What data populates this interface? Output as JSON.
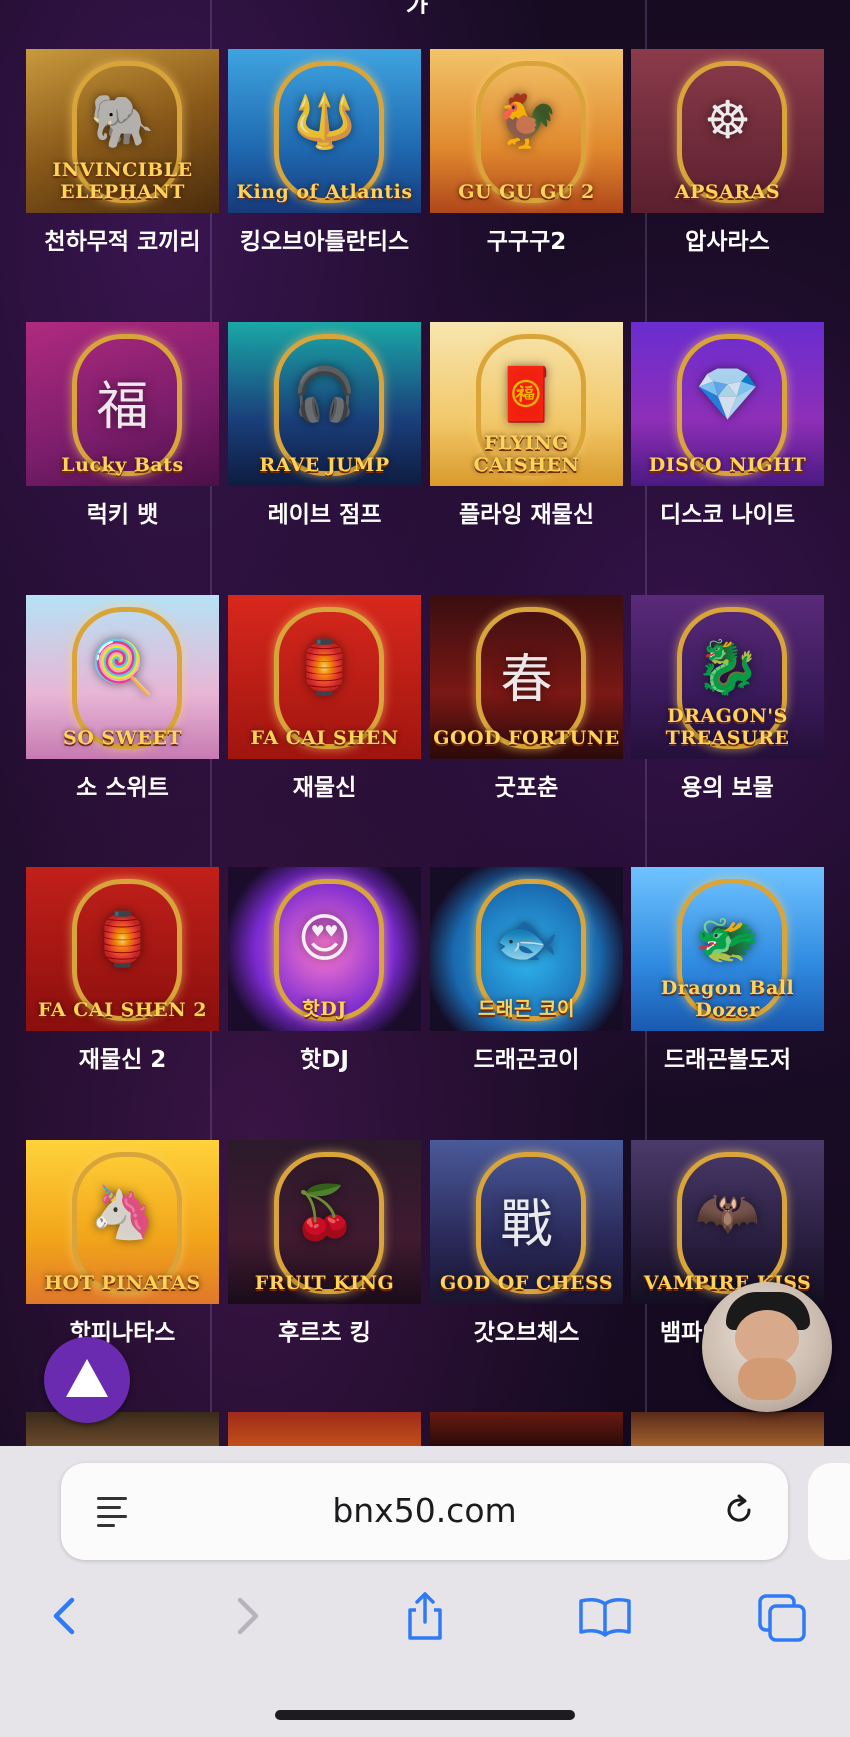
{
  "colors": {
    "accent_blue": "#2f7bf5",
    "up_button": "#6a2bb0",
    "gold": "#ffd25a"
  },
  "header_partial_text": "가",
  "games": [
    {
      "name": "천하무적 코끼리",
      "logo": "INVINCIBLE ELEPHANT",
      "bg": "linear-gradient(160deg,#c99a3d 0%,#8a5a1a 50%,#4a2c0c 100%)",
      "glyph": "🐘"
    },
    {
      "name": "킹오브아틀란티스",
      "logo": "King of Atlantis",
      "bg": "linear-gradient(180deg,#3fa4e0 0%,#1f6ab2 60%,#173a7a 100%)",
      "glyph": "🔱"
    },
    {
      "name": "구구구2",
      "logo": "GU GU GU 2",
      "bg": "linear-gradient(180deg,#f3c46a 0%,#e0892e 60%,#b0471a 100%)",
      "glyph": "🐓"
    },
    {
      "name": "압사라스",
      "logo": "APSARAS",
      "bg": "linear-gradient(180deg,#8b3b4a 0%,#5a1f2e 100%)",
      "glyph": "☸"
    },
    {
      "name": "럭키 뱃",
      "logo": "Lucky Bats",
      "bg": "linear-gradient(160deg,#b02a80 0%,#7a1d6a 60%,#4c0f48 100%)",
      "glyph": "福"
    },
    {
      "name": "레이브 점프",
      "logo": "RAVE JUMP",
      "bg": "linear-gradient(180deg,#1aa8a6 0%,#1a3e7a 60%,#0e1c40 100%)",
      "glyph": "🎧"
    },
    {
      "name": "플라잉 재물신",
      "logo": "FLYING CAISHEN",
      "bg": "linear-gradient(180deg,#f7e6b0 0%,#f2c86a 60%,#d99a2b 100%)",
      "glyph": "🧧"
    },
    {
      "name": "디스코 나이트",
      "logo": "DISCO NIGHT",
      "bg": "linear-gradient(180deg,#6a2dd0 0%,#8e2fb8 60%,#4a1a80 100%)",
      "glyph": "💎"
    },
    {
      "name": "소 스위트",
      "logo": "SO SWEET",
      "bg": "linear-gradient(180deg,#b6e2f5 0%,#e8b6d6 60%,#c77ab2 100%)",
      "glyph": "🍭"
    },
    {
      "name": "재물신",
      "logo": "FA CAI SHEN",
      "bg": "linear-gradient(180deg,#d8281d 0%,#a0150f 100%)",
      "glyph": "🏮"
    },
    {
      "name": "굿포춘",
      "logo": "GOOD FORTUNE",
      "bg": "linear-gradient(180deg,#3a0e10 0%,#7a1814 60%,#2a0a0a 100%)",
      "glyph": "春"
    },
    {
      "name": "용의 보물",
      "logo": "DRAGON'S TREASURE",
      "bg": "linear-gradient(180deg,#5a2a7a 0%,#3a1a5a 60%,#24103a 100%)",
      "glyph": "🐉"
    },
    {
      "name": "재물신 2",
      "logo": "FA CAI SHEN 2",
      "bg": "linear-gradient(180deg,#c2201a 0%,#8a0f0d 100%)",
      "glyph": "🏮"
    },
    {
      "name": "핫DJ",
      "logo": "핫DJ",
      "bg": "radial-gradient(circle at 50% 50%,#ff7ad0 0%,#7a2ad0 55%,#1a0c2a 80%)",
      "glyph": "😍"
    },
    {
      "name": "드래곤코이",
      "logo": "드래곤 코이",
      "bg": "radial-gradient(circle at 50% 55%,#30b6f0 0%,#1a6ab0 55%,#150c25 78%)",
      "glyph": "🐟"
    },
    {
      "name": "드래곤볼도저",
      "logo": "Dragon Ball Dozer",
      "bg": "linear-gradient(180deg,#6fc3ff 0%,#2f8ae0 60%,#1a5ab0 100%)",
      "glyph": "🐲"
    },
    {
      "name": "핫피나타스",
      "logo": "HOT PINATAS",
      "bg": "linear-gradient(180deg,#ffd23a 0%,#f2a51a 60%,#e0782a 100%)",
      "glyph": "🦄"
    },
    {
      "name": "후르츠 킹",
      "logo": "FRUIT KING",
      "bg": "linear-gradient(180deg,#2a1a2a 0%,#401a30 60%,#1a0c1a 100%)",
      "glyph": "🍒"
    },
    {
      "name": "갓오브체스",
      "logo": "GOD OF CHESS",
      "bg": "linear-gradient(180deg,#4a5a9a 0%,#2a2a5a 60%,#1a1430 100%)",
      "glyph": "戰"
    },
    {
      "name": "뱀파이어 키스",
      "logo": "VAMPIRE KISS",
      "bg": "linear-gradient(180deg,#4a3a6a 0%,#2a1f40 60%,#140f22 100%)",
      "glyph": "🦇"
    }
  ],
  "next_row_bgs": [
    "linear-gradient(180deg,#3a2a1a 0%,#6a4a2a 100%)",
    "linear-gradient(180deg,#a02a1a 0%,#c0501a 100%)",
    "linear-gradient(180deg,#6a1a10 0%,#2a0a0a 100%)",
    "linear-gradient(180deg,#5a2a1a 0%,#a0602a 100%)"
  ],
  "browser": {
    "url": "bnx50.com",
    "icons": [
      "reader-icon",
      "reload-icon",
      "back-icon",
      "forward-icon",
      "share-icon",
      "bookmarks-icon",
      "tabs-icon"
    ]
  }
}
